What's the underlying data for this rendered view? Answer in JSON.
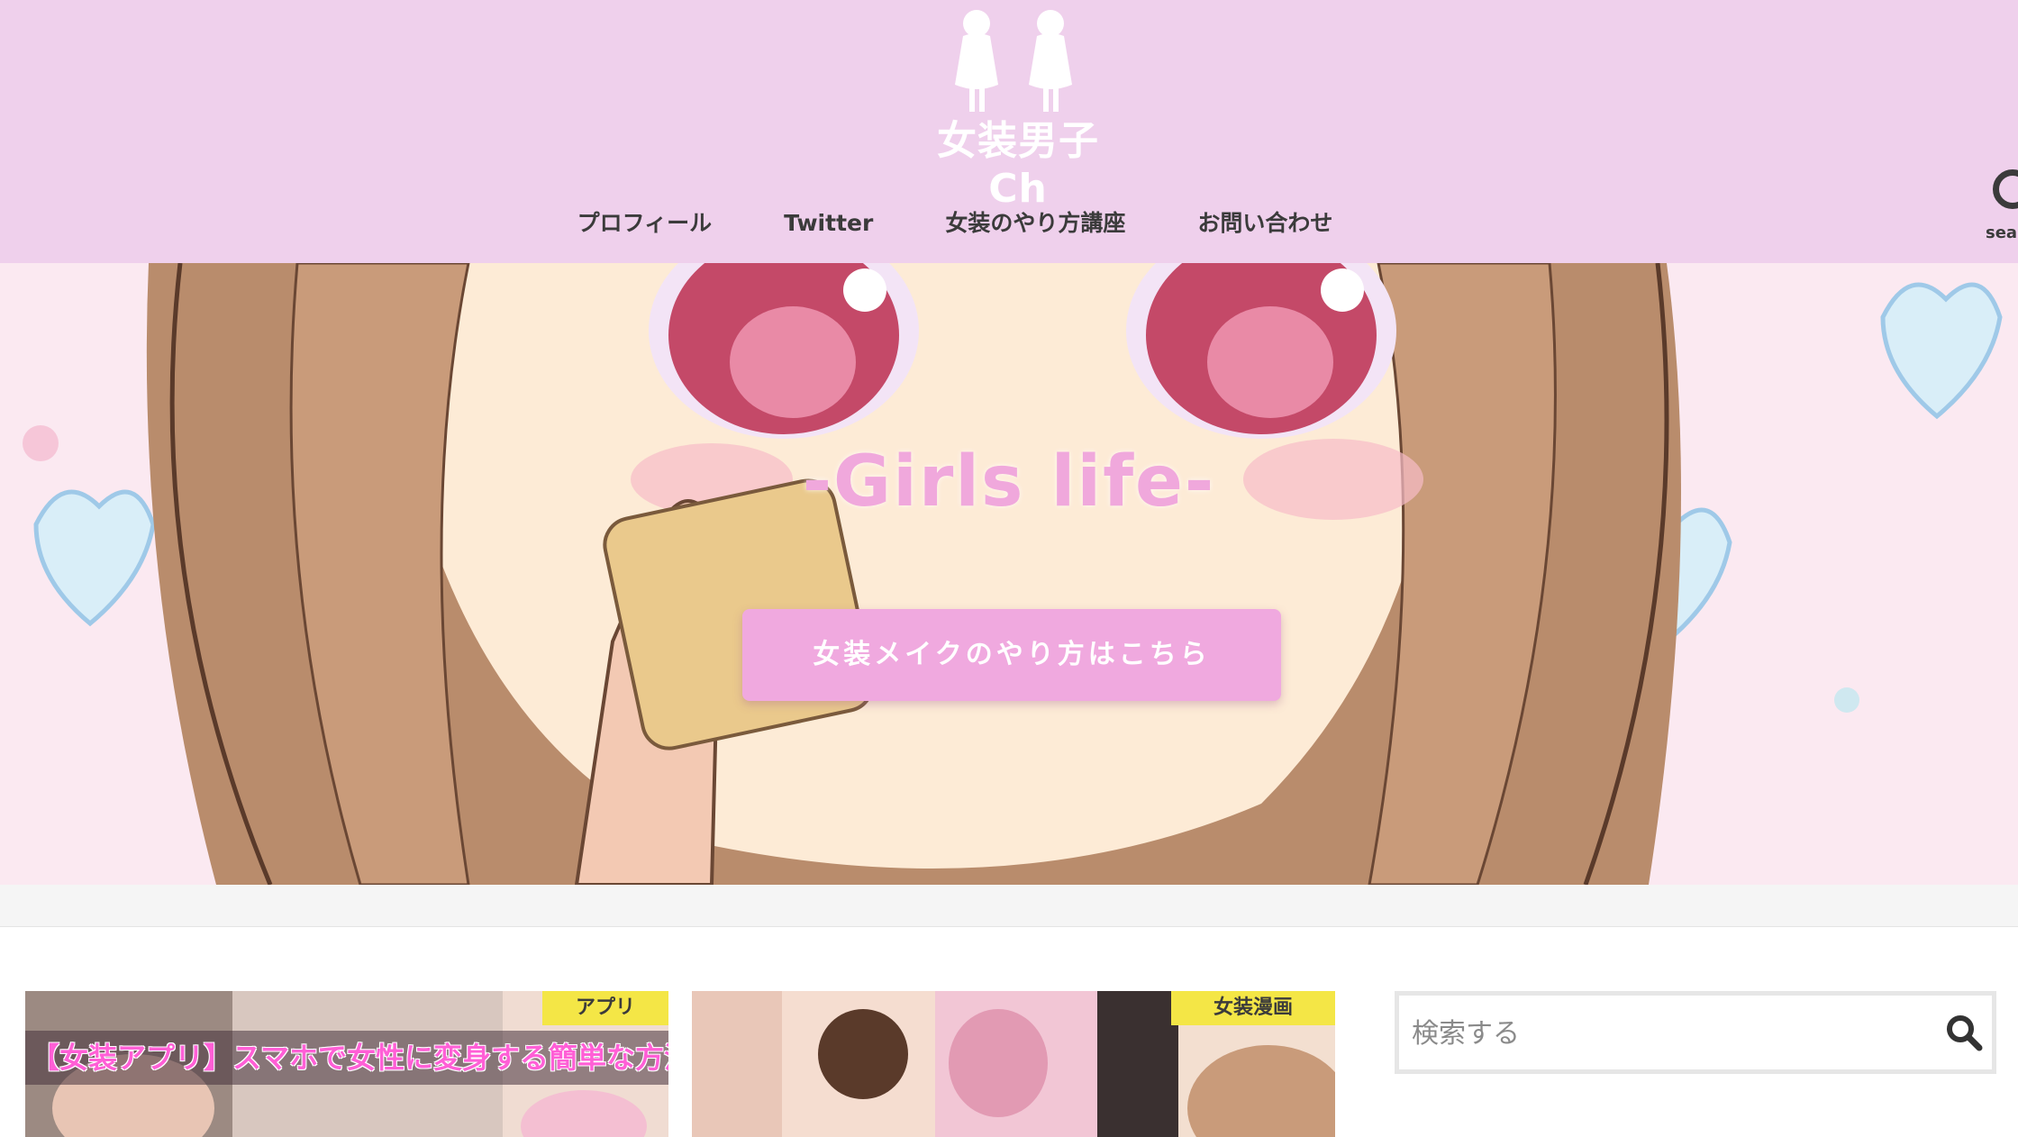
{
  "site": {
    "logo_text": "女装男子Ch",
    "colors": {
      "header_bg": "#efd0ec",
      "accent_pink": "#f0a9df",
      "badge_yellow": "#f4e646"
    }
  },
  "nav": {
    "items": [
      {
        "label": "プロフィール"
      },
      {
        "label": "Twitter"
      },
      {
        "label": "女装のやり方講座"
      },
      {
        "label": "お問い合わせ"
      }
    ],
    "search_toggle_label": "sea",
    "search_icon": "search-icon"
  },
  "hero": {
    "title": "-Girls life-",
    "cta_label": "女装メイクのやり方はこちら"
  },
  "cards": [
    {
      "badge": "アプリ",
      "title": "【女装アプリ】スマホで女性に変身する簡単な方法"
    },
    {
      "badge": "女装漫画"
    }
  ],
  "sidebar": {
    "search": {
      "placeholder": "検索する",
      "icon": "search-icon"
    }
  }
}
